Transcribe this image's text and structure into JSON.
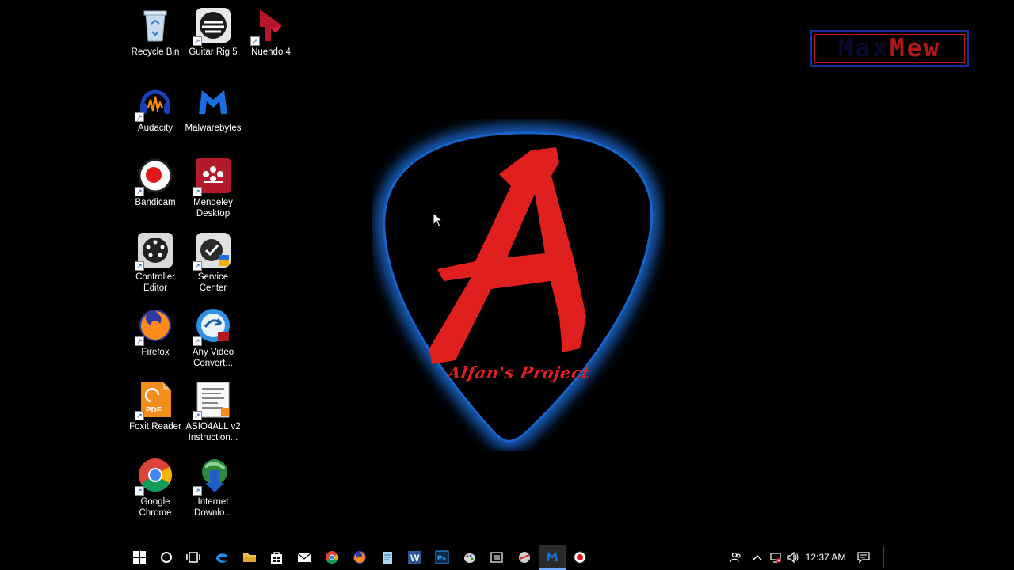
{
  "desktop": {
    "icons": [
      {
        "label": "Recycle Bin",
        "icon": "recycle-bin-icon"
      },
      {
        "label": "Guitar Rig 5",
        "icon": "guitar-rig-icon"
      },
      {
        "label": "Nuendo 4",
        "icon": "nuendo-icon"
      },
      {
        "label": "Audacity",
        "icon": "audacity-icon"
      },
      {
        "label": "Malwarebytes",
        "icon": "malwarebytes-icon"
      },
      {
        "label": "Bandicam",
        "icon": "bandicam-icon"
      },
      {
        "label": "Mendeley Desktop",
        "icon": "mendeley-icon"
      },
      {
        "label": "Controller Editor",
        "icon": "controller-editor-icon"
      },
      {
        "label": "Service Center",
        "icon": "service-center-icon"
      },
      {
        "label": "Firefox",
        "icon": "firefox-icon"
      },
      {
        "label": "Any Video Convert...",
        "icon": "any-video-converter-icon"
      },
      {
        "label": "Foxit Reader",
        "icon": "foxit-reader-icon"
      },
      {
        "label": "ASIO4ALL v2 Instruction...",
        "icon": "document-icon"
      },
      {
        "label": "Google Chrome",
        "icon": "chrome-icon"
      },
      {
        "label": "Internet Downlo...",
        "icon": "internet-download-manager-icon"
      }
    ]
  },
  "wallpaper": {
    "caption": "Alfan's Project",
    "accent": "#e0201f",
    "glow": "#1e6fe0"
  },
  "watermark": {
    "part1": "Max",
    "part2": "Mew"
  },
  "taskbar": {
    "pinned": [
      "start-icon",
      "cortana-search-icon",
      "task-view-icon",
      "edge-icon",
      "file-explorer-icon",
      "store-icon",
      "mail-icon",
      "chrome-icon",
      "firefox-icon",
      "notepad-icon",
      "word-icon",
      "photoshop-icon",
      "paint-icon",
      "media-icon",
      "network-app-icon",
      "malwarebytes-icon",
      "bandicam-icon"
    ],
    "clock": "12:37 AM"
  }
}
